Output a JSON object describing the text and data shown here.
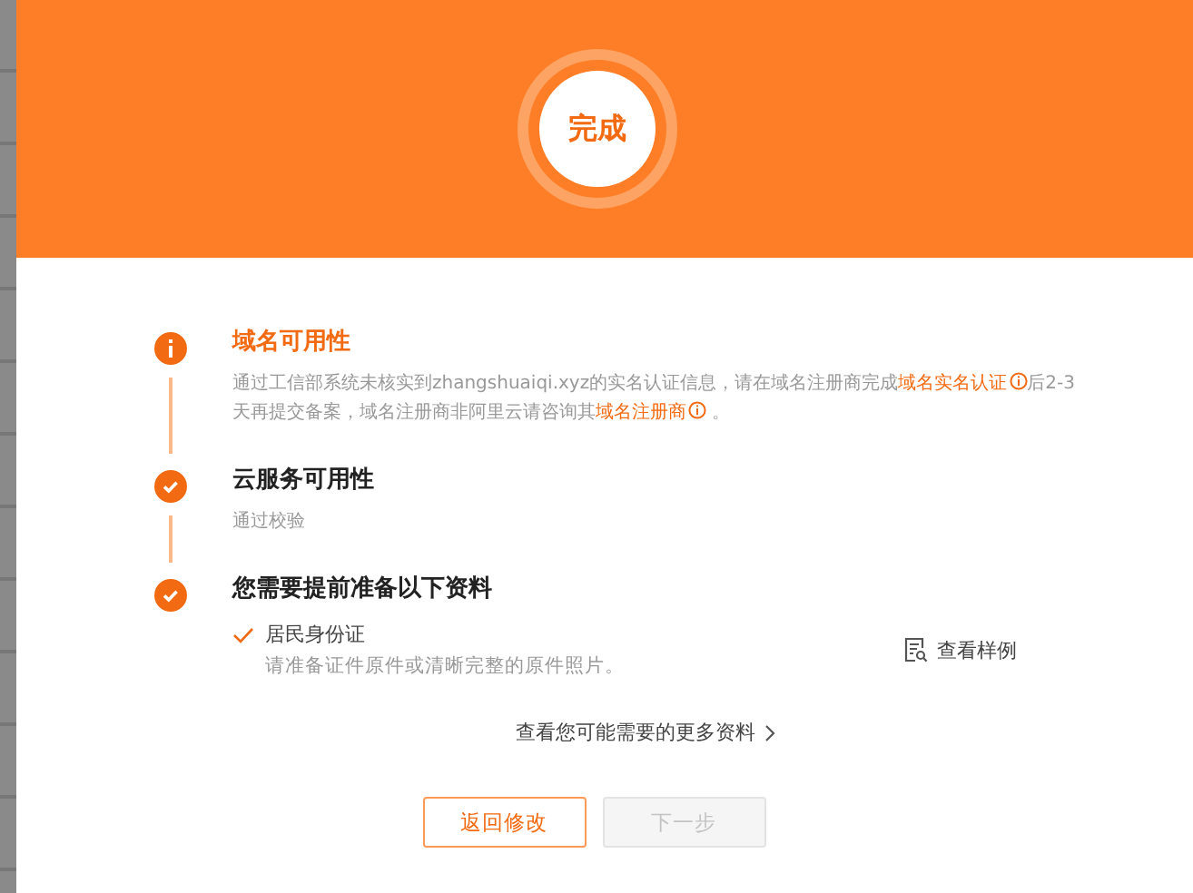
{
  "header": {
    "status": "完成"
  },
  "steps": [
    {
      "kind": "warning",
      "title": "域名可用性",
      "description": [
        {
          "text": "通过工信部系统未核实到zhangshuaiqi.xyz的实名认证信息，请在域名注册商完成",
          "link": false
        },
        {
          "text": "域名实名认证",
          "link": true
        },
        {
          "text": "后2-3天再提交备案，域名注册商非阿里云请咨询其",
          "link": false
        },
        {
          "text": "域名注册商",
          "link": true
        },
        {
          "text": " 。",
          "link": false
        }
      ]
    },
    {
      "kind": "done",
      "title": "云服务可用性",
      "description": [
        {
          "text": "通过校验",
          "link": false
        }
      ]
    },
    {
      "kind": "done",
      "title": "您需要提前准备以下资料",
      "materials": [
        {
          "checked": true,
          "name": "居民身份证",
          "note": "请准备证件原件或清晰完整的原件照片。",
          "action": "查看样例"
        }
      ]
    }
  ],
  "more_link": "查看您可能需要的更多资料",
  "buttons": [
    {
      "label": "返回修改",
      "disabled": false
    },
    {
      "label": "下一步",
      "disabled": true
    }
  ]
}
